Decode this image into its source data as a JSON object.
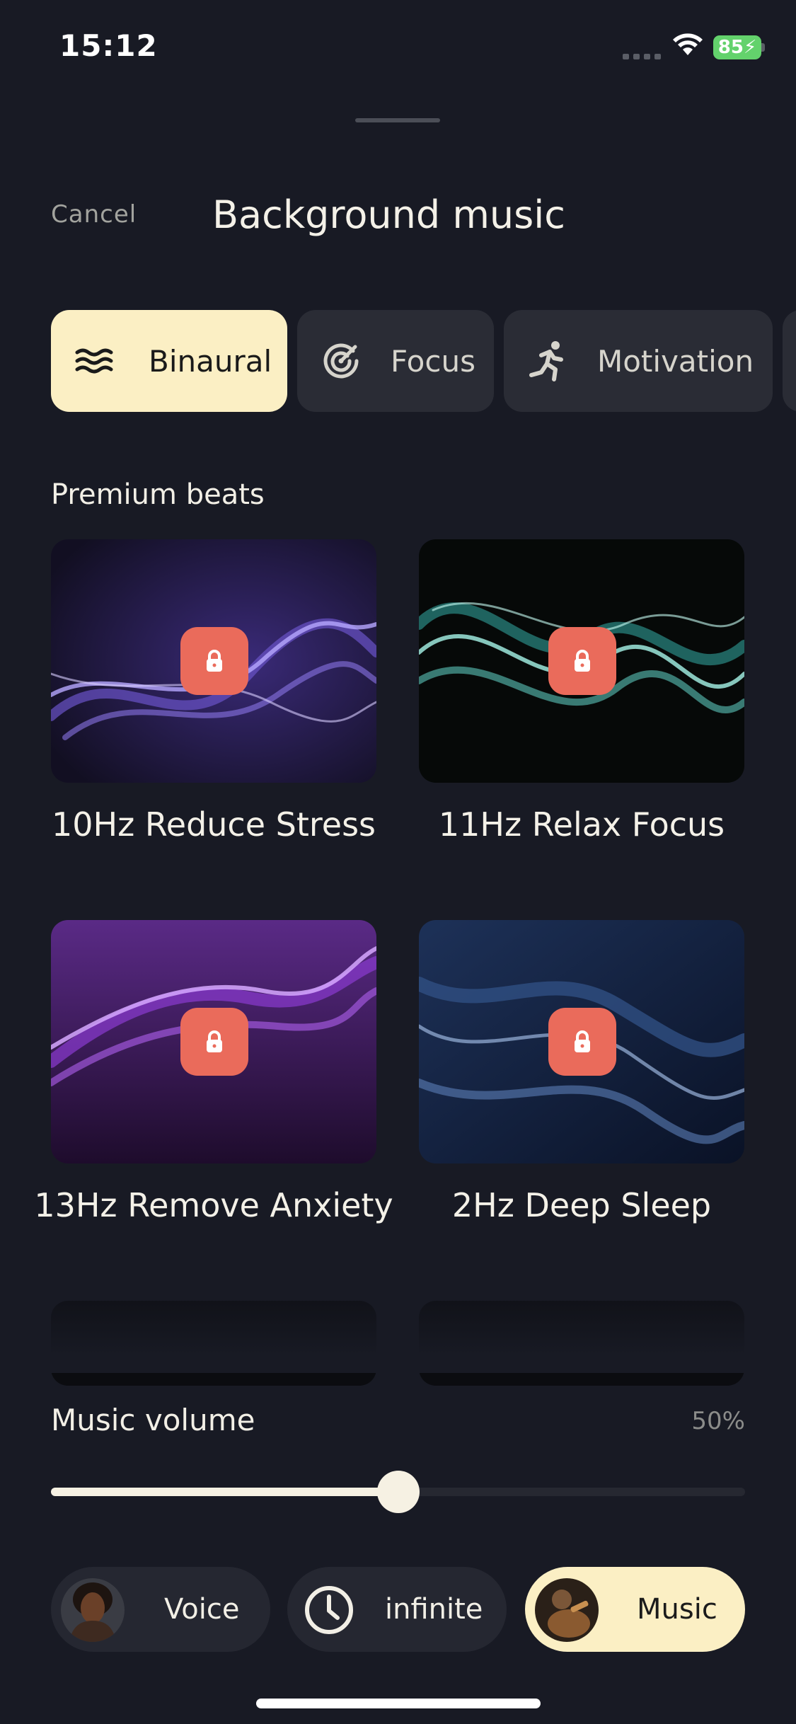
{
  "status": {
    "time": "15:12",
    "battery": "85"
  },
  "header": {
    "cancel_label": "Cancel",
    "title": "Background music"
  },
  "categories": [
    {
      "label": "Binaural",
      "icon": "waves-icon",
      "active": true
    },
    {
      "label": "Focus",
      "icon": "target-icon",
      "active": false
    },
    {
      "label": "Motivation",
      "icon": "running-person-icon",
      "active": false
    }
  ],
  "section_title": "Premium beats",
  "beats": [
    {
      "title": "10Hz Reduce Stress",
      "locked": true,
      "colors": [
        "#1a1630",
        "#6a52c8",
        "#b7a8ff"
      ]
    },
    {
      "title": "11Hz Relax Focus",
      "locked": true,
      "colors": [
        "#060908",
        "#2b8a84",
        "#9ee8dc"
      ]
    },
    {
      "title": "13Hz Remove Anxiety",
      "locked": true,
      "colors": [
        "#2a0f3a",
        "#8a3ad0",
        "#d6a8ff"
      ]
    },
    {
      "title": "2Hz Deep Sleep",
      "locked": true,
      "colors": [
        "#0e1a33",
        "#2f4f82",
        "#9ab4dc"
      ]
    }
  ],
  "volume": {
    "label": "Music volume",
    "value_text": "50%",
    "value": 0.5
  },
  "bottom_bar": {
    "voice_label": "Voice",
    "timer_label": "infinite",
    "music_label": "Music"
  },
  "colors": {
    "accent": "#fbefc4",
    "lock": "#ea6b5b",
    "background": "#181a24"
  }
}
